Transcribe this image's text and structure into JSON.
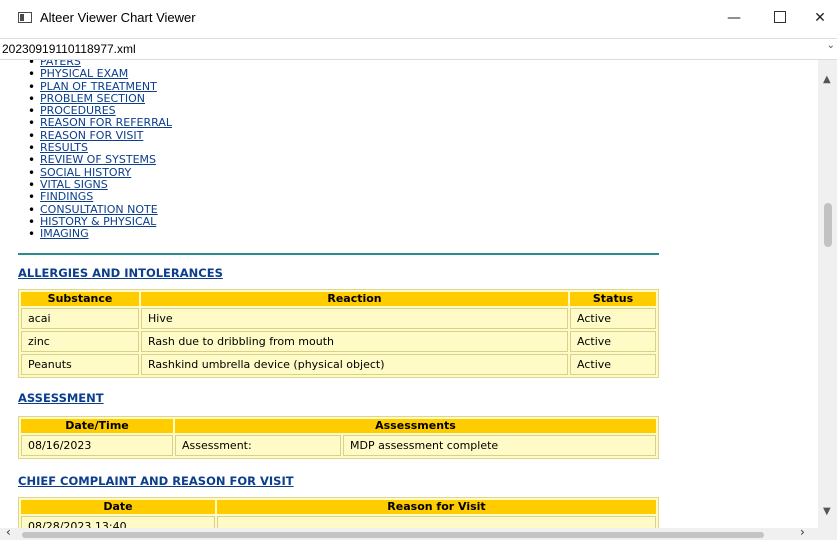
{
  "window": {
    "title": "Alteer Viewer Chart Viewer",
    "minimize": "—",
    "close": "✕"
  },
  "file": {
    "name": "20230919110118977.xml"
  },
  "toc": [
    "PAYERS",
    "PHYSICAL EXAM",
    "PLAN OF TREATMENT",
    "PROBLEM SECTION",
    "PROCEDURES",
    "REASON FOR REFERRAL",
    "REASON FOR VISIT",
    "RESULTS",
    "REVIEW OF SYSTEMS",
    "SOCIAL HISTORY",
    "VITAL SIGNS",
    "FINDINGS",
    "CONSULTATION NOTE",
    "HISTORY & PHYSICAL",
    "IMAGING"
  ],
  "allergies": {
    "heading": "ALLERGIES AND INTOLERANCES",
    "columns": {
      "substance": "Substance",
      "reaction": "Reaction",
      "status": "Status"
    },
    "rows": [
      {
        "substance": "acai",
        "reaction": "Hive",
        "status": "Active"
      },
      {
        "substance": "zinc",
        "reaction": "Rash due to dribbling from mouth",
        "status": "Active"
      },
      {
        "substance": "Peanuts",
        "reaction": "Rashkind umbrella device (physical object)",
        "status": "Active"
      }
    ]
  },
  "assessment": {
    "heading": "ASSESSMENT",
    "columns": {
      "datetime": "Date/Time",
      "assessments": "Assessments"
    },
    "rows": [
      {
        "datetime": "08/16/2023",
        "label": "Assessment:",
        "value": "MDP assessment complete"
      }
    ]
  },
  "chief_complaint": {
    "heading": "CHIEF COMPLAINT AND REASON FOR VISIT",
    "columns": {
      "date": "Date",
      "reason": "Reason for Visit"
    },
    "rows": [
      {
        "date": "08/28/2023 13:40",
        "reason": ""
      }
    ]
  },
  "colors": {
    "header_fill": "#ffcc00",
    "cell_fill": "#fffbc6",
    "link": "#0b3e8c",
    "rule": "#2b8a8e"
  }
}
